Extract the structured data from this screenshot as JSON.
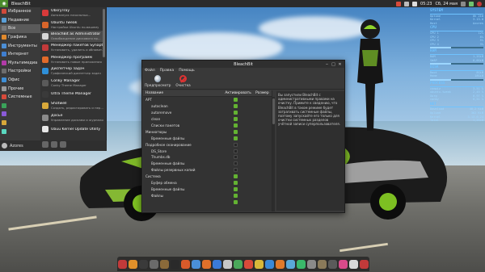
{
  "top_panel": {
    "window_title": "BleachBit",
    "time": "05:23",
    "date": "Сб, 24 мая",
    "tray_icons": [
      "update-icon",
      "network-icon",
      "volume-icon",
      "chat-icon",
      "battery-icon",
      "power-icon"
    ]
  },
  "menu": {
    "categories": [
      {
        "icon": "star-icon",
        "label": "Избранное",
        "color": "#d24a3a"
      },
      {
        "icon": "clock-icon",
        "label": "Недавние",
        "color": "#5aa0d8"
      },
      {
        "icon": "apps-icon",
        "label": "Все",
        "color": "#7a7a7a",
        "active": true
      },
      {
        "icon": "graphics-icon",
        "label": "Графика",
        "color": "#e1892c"
      },
      {
        "icon": "tools-icon",
        "label": "Инструменты",
        "color": "#4c8fd6"
      },
      {
        "icon": "globe-icon",
        "label": "Интернет",
        "color": "#3f7fd0"
      },
      {
        "icon": "media-icon",
        "label": "Мультимедиа",
        "color": "#b23aa8"
      },
      {
        "icon": "wrench-icon",
        "label": "Настройки",
        "color": "#6d6d6d"
      },
      {
        "icon": "office-icon",
        "label": "Офис",
        "color": "#3e8fd7"
      },
      {
        "icon": "other-icon",
        "label": "Прочие",
        "color": "#9a9a9a"
      },
      {
        "icon": "system-icon",
        "label": "Системные",
        "color": "#d84a3a"
      },
      {
        "icon": "games-icon",
        "label": "",
        "color": "#3aa35a"
      },
      {
        "icon": "extras-icon",
        "label": "",
        "color": "#8a5ad8"
      },
      {
        "icon": "dev-icon",
        "label": "",
        "color": "#d8a83a"
      },
      {
        "icon": "edu-icon",
        "label": "",
        "color": "#5ad8c0"
      }
    ],
    "apps": [
      {
        "icon": "obsrytray-icon",
        "name": "ObsryTray",
        "desc": "Автозапуск начальных...",
        "color": "#d83a3a"
      },
      {
        "icon": "ubuntu-tweak-icon",
        "name": "Ubuntu Tweak",
        "desc": "Настройки Ubuntu по-вашему",
        "color": "#d8652a"
      },
      {
        "icon": "bleachbit-admin-icon",
        "name": "BleachBit as Administrator",
        "desc": "Освобождение дискового пр...",
        "color": "#d8d8d8",
        "active": true
      },
      {
        "icon": "synaptic-icon",
        "name": "Менеджер пакетов Synaptic",
        "desc": "Установить, удалить и обновит...",
        "color": "#c23a3a"
      },
      {
        "icon": "software-manager-icon",
        "name": "Менеджер программ",
        "desc": "Установить новые приложения",
        "color": "#e06a2a"
      },
      {
        "icon": "task-manager-icon",
        "name": "Диспетчер задач",
        "desc": "Графический диспетчер задач",
        "color": "#2e8fd8"
      },
      {
        "icon": "conky-manager-icon",
        "name": "Conky Manager",
        "desc": "Conky Theme Manager",
        "color": "#5a5a5a"
      },
      {
        "icon": "ultra-theme-icon",
        "name": "Ultra Theme Manager",
        "desc": "",
        "color": "#3a3a3a"
      },
      {
        "icon": "shotwell-icon",
        "name": "Shotwell",
        "desc": "Создать, редактировать и пер...",
        "color": "#d8a83a"
      },
      {
        "icon": "dosbox-icon",
        "name": "Досье",
        "desc": "Управление досками и журналом...",
        "color": "#8a8a8a"
      },
      {
        "icon": "kernel-update-icon",
        "name": "Ubuu Kernel Update Utility",
        "desc": "",
        "color": "#e6e6e6"
      }
    ],
    "username": "Azores"
  },
  "window": {
    "title": "BleachBit",
    "menubar": [
      "Файл",
      "Правка",
      "Помощь"
    ],
    "toolbar": {
      "preview_label": "Предпросмотр",
      "clean_label": "Очистка"
    },
    "columns": {
      "name": "Название",
      "active": "Активировать",
      "size": "Размер"
    },
    "rows": [
      {
        "name": "APT",
        "level": 0,
        "checked": true
      },
      {
        "name": "autoclean",
        "level": 1,
        "checked": true
      },
      {
        "name": "autoremove",
        "level": 1,
        "checked": true
      },
      {
        "name": "clean",
        "level": 1,
        "checked": true
      },
      {
        "name": "Списки пакетов",
        "level": 1,
        "checked": true
      },
      {
        "name": "Миниатюры",
        "level": 0,
        "checked": true
      },
      {
        "name": "Временные файлы",
        "level": 1,
        "checked": true
      },
      {
        "name": "Подробное сканирование",
        "level": 0,
        "checked": false
      },
      {
        "name": "DS_Store",
        "level": 1,
        "checked": false
      },
      {
        "name": "Thumbs.db",
        "level": 1,
        "checked": false
      },
      {
        "name": "Временные файлы",
        "level": 1,
        "checked": false
      },
      {
        "name": "Файлы резервных копий",
        "level": 1,
        "checked": false
      },
      {
        "name": "Система",
        "level": 0,
        "checked": true
      },
      {
        "name": "Буфер обмена",
        "level": 1,
        "checked": true
      },
      {
        "name": "Временные файлы",
        "level": 1,
        "checked": true
      },
      {
        "name": "Файлы",
        "level": 1,
        "checked": true
      },
      {
        "name": "",
        "level": 1,
        "checked": true
      }
    ],
    "description": "Вы запустили BleachBit с административными правами на очистку. Примите к сведению, что BleachBit в таком режиме будет затрагивать системные файлы, поэтому запускайте его только для очистки системных разделов учётной записи суперпользователя."
  },
  "conky": {
    "system_title": "SYSTEM",
    "system_rows": [
      [
        "Uptime",
        "0h 21m"
      ],
      [
        "Kernel",
        "3.13.0"
      ],
      [
        "Host",
        "Azores"
      ]
    ],
    "cpu_title": "CPU",
    "cpu_rows": [
      [
        "CPU 1",
        "12%"
      ],
      [
        "CPU 2",
        "8%"
      ],
      [
        "CPU 3",
        "5%"
      ],
      [
        "CPU 4",
        "3%"
      ]
    ],
    "ram_title": "RAM",
    "ram_rows": [
      [
        "RAM",
        "1,2GiB"
      ],
      [
        "SWAP",
        "0,0GiB"
      ]
    ],
    "disk_title": "DISK",
    "disk_rows": [
      [
        "Root",
        "8GiB"
      ],
      [
        "Home",
        "18GiB"
      ]
    ],
    "process_title": "PROCESS",
    "process_rows": [
      [
        "compiz",
        "3,51 %"
      ],
      [
        "ubuntu-tweak",
        "2,45 %"
      ],
      [
        "Xorg",
        "0,97 %"
      ],
      [
        "conky",
        "0,51 %"
      ]
    ],
    "net_title": "NET",
    "net_rows": [
      [
        "Download",
        "40,2 KiB"
      ],
      [
        "Upload",
        "362 KiB"
      ]
    ],
    "bottom_rows": [
      [
        "Kernel",
        "3.13.0-24"
      ],
      [
        "Total",
        "1,2GiB"
      ]
    ]
  },
  "dock": {
    "icons": [
      {
        "name": "files-icon",
        "color": "#c23a3a"
      },
      {
        "name": "folder-icon",
        "color": "#e0902a"
      },
      {
        "name": "terminal-icon",
        "color": "#3a3a3a"
      },
      {
        "name": "settings-icon",
        "color": "#6a6a6a"
      },
      {
        "name": "archive-icon",
        "color": "#8a6a3a"
      },
      {
        "name": "shell-icon",
        "color": "#2a2a2a"
      },
      {
        "name": "image-viewer-icon",
        "color": "#d85a2a"
      },
      {
        "name": "chromium-icon",
        "color": "#4a8fd8"
      },
      {
        "name": "firefox-icon",
        "color": "#e0702a"
      },
      {
        "name": "mail-icon",
        "color": "#3a7ad8"
      },
      {
        "name": "text-editor-icon",
        "color": "#c8c8c8"
      },
      {
        "name": "libreoffice-icon",
        "color": "#4aa85a"
      },
      {
        "name": "calendar-icon",
        "color": "#d84a3a"
      },
      {
        "name": "music-icon",
        "color": "#d8b83a"
      },
      {
        "name": "video-icon",
        "color": "#3a8ad8"
      },
      {
        "name": "vlc-icon",
        "color": "#e07a2a"
      },
      {
        "name": "photo-icon",
        "color": "#5aa8d8"
      },
      {
        "name": "chat-icon",
        "color": "#3ab86a"
      },
      {
        "name": "trash-icon",
        "color": "#8a8a8a"
      },
      {
        "name": "gimp-icon",
        "color": "#8a7a5a"
      },
      {
        "name": "camera-icon",
        "color": "#5a5a5a"
      },
      {
        "name": "game-icon",
        "color": "#d84a8a"
      },
      {
        "name": "bleachbit-icon",
        "color": "#d8d8d8"
      },
      {
        "name": "power-icon",
        "color": "#c23a3a"
      }
    ]
  }
}
